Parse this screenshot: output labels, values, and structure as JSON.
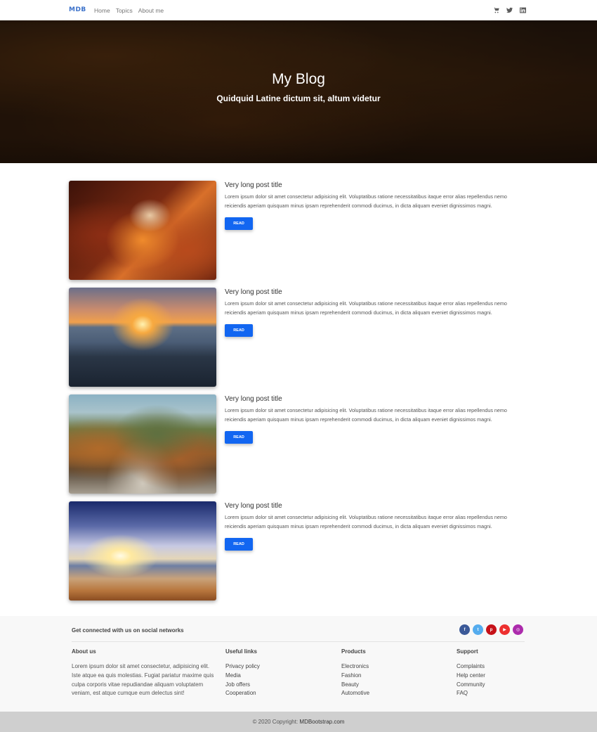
{
  "navbar": {
    "brand": "MDB",
    "links": [
      "Home",
      "Topics",
      "About me"
    ],
    "icons": [
      "cart-icon",
      "twitter-icon",
      "linkedin-icon"
    ]
  },
  "hero": {
    "title": "My Blog",
    "subtitle": "Quidquid Latine dictum sit, altum videtur"
  },
  "posts": [
    {
      "title": "Very long post title",
      "text": "Lorem ipsum dolor sit amet consectetur adipisicing elit. Voluptatibus ratione necessitatibus itaque error alias repellendus nemo reiciendis aperiam quisquam minus ipsam reprehenderit commodi ducimus, in dicta aliquam eveniet dignissimos magni.",
      "button": "READ",
      "image": "canyon"
    },
    {
      "title": "Very long post title",
      "text": "Lorem ipsum dolor sit amet consectetur adipisicing elit. Voluptatibus ratione necessitatibus itaque error alias repellendus nemo reiciendis aperiam quisquam minus ipsam reprehenderit commodi ducimus, in dicta aliquam eveniet dignissimos magni.",
      "button": "READ",
      "image": "sunset"
    },
    {
      "title": "Very long post title",
      "text": "Lorem ipsum dolor sit amet consectetur adipisicing elit. Voluptatibus ratione necessitatibus itaque error alias repellendus nemo reiciendis aperiam quisquam minus ipsam reprehenderit commodi ducimus, in dicta aliquam eveniet dignissimos magni.",
      "button": "READ",
      "image": "mountain"
    },
    {
      "title": "Very long post title",
      "text": "Lorem ipsum dolor sit amet consectetur adipisicing elit. Voluptatibus ratione necessitatibus itaque error alias repellendus nemo reiciendis aperiam quisquam minus ipsam reprehenderit commodi ducimus, in dicta aliquam eveniet dignissimos magni.",
      "button": "READ",
      "image": "beach"
    }
  ],
  "footer": {
    "social_text": "Get connected with us on social networks",
    "social_icons": [
      {
        "name": "facebook-icon",
        "glyph": "f",
        "color": "#3b5998"
      },
      {
        "name": "twitter-icon",
        "glyph": "t",
        "color": "#55acee"
      },
      {
        "name": "pinterest-icon",
        "glyph": "p",
        "color": "#c61118"
      },
      {
        "name": "youtube-icon",
        "glyph": "▶",
        "color": "#ed302f"
      },
      {
        "name": "instagram-icon",
        "glyph": "◎",
        "color": "#ac2bac"
      }
    ],
    "about": {
      "title": "About us",
      "text": "Lorem ipsum dolor sit amet consectetur, adipisicing elit. Iste atque ea quis molestias. Fugiat pariatur maxime quis culpa corporis vitae repudiandae aliquam voluptatem veniam, est atque cumque eum delectus sint!"
    },
    "useful_links": {
      "title": "Useful links",
      "items": [
        "Privacy policy",
        "Media",
        "Job offers",
        "Cooperation"
      ]
    },
    "products": {
      "title": "Products",
      "items": [
        "Electronics",
        "Fashion",
        "Beauty",
        "Automotive"
      ]
    },
    "support": {
      "title": "Support",
      "items": [
        "Complaints",
        "Help center",
        "Community",
        "FAQ"
      ]
    },
    "copyright_prefix": "© 2020 Copyright:",
    "copyright_link": "MDBootstrap.com"
  }
}
